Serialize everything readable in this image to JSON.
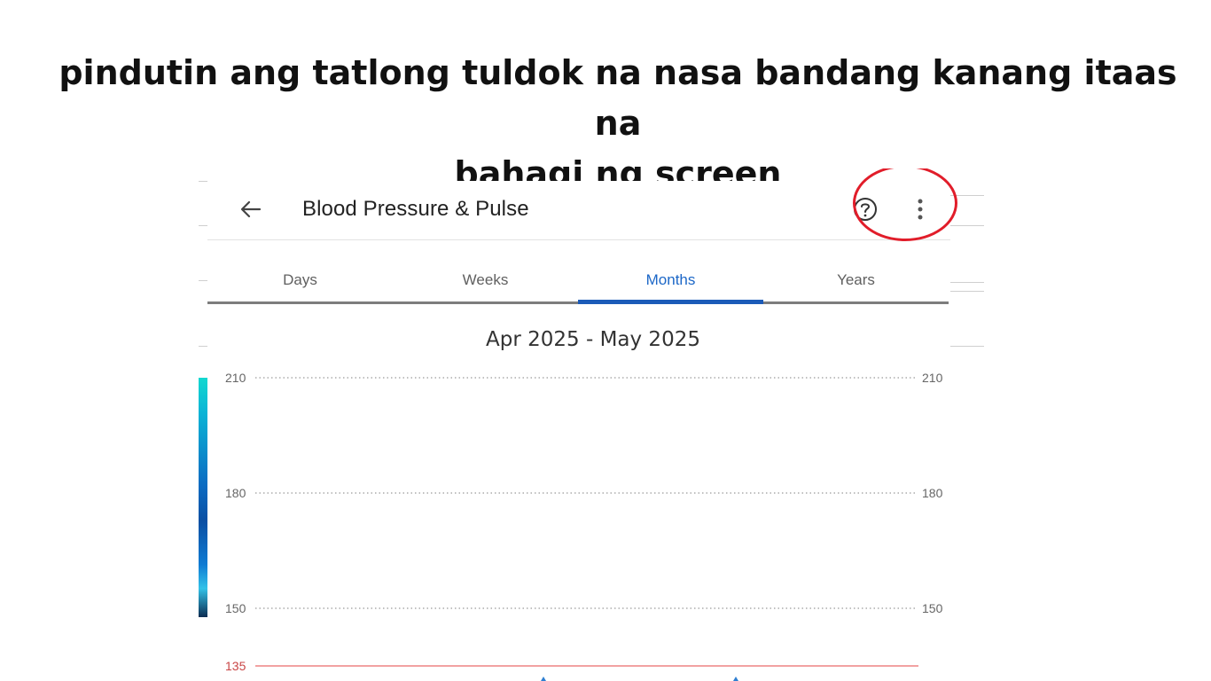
{
  "instruction": {
    "line1": "pindutin ang tatlong tuldok na nasa bandang kanang itaas na",
    "line2": "bahagi ng screen"
  },
  "appbar": {
    "title": "Blood Pressure & Pulse",
    "back_icon": "arrow-left-icon",
    "help_icon": "help-circle-icon",
    "more_icon": "more-vertical-icon"
  },
  "highlight": {
    "color": "#e11d2a"
  },
  "tabs": [
    {
      "label": "Days",
      "active": false
    },
    {
      "label": "Weeks",
      "active": false
    },
    {
      "label": "Months",
      "active": true
    },
    {
      "label": "Years",
      "active": false
    }
  ],
  "date_range": "Apr 2025 - May 2025",
  "chart_data": {
    "type": "line",
    "y_ticks_left": [
      "210",
      "180",
      "150",
      "135"
    ],
    "y_ticks_right": [
      "210",
      "180",
      "150"
    ],
    "threshold": {
      "value": 135,
      "color": "#f2a2a2",
      "label": "135"
    },
    "grid": "dotted"
  },
  "colors": {
    "accent": "#1c67c7",
    "threshold_label": "#c94545"
  }
}
